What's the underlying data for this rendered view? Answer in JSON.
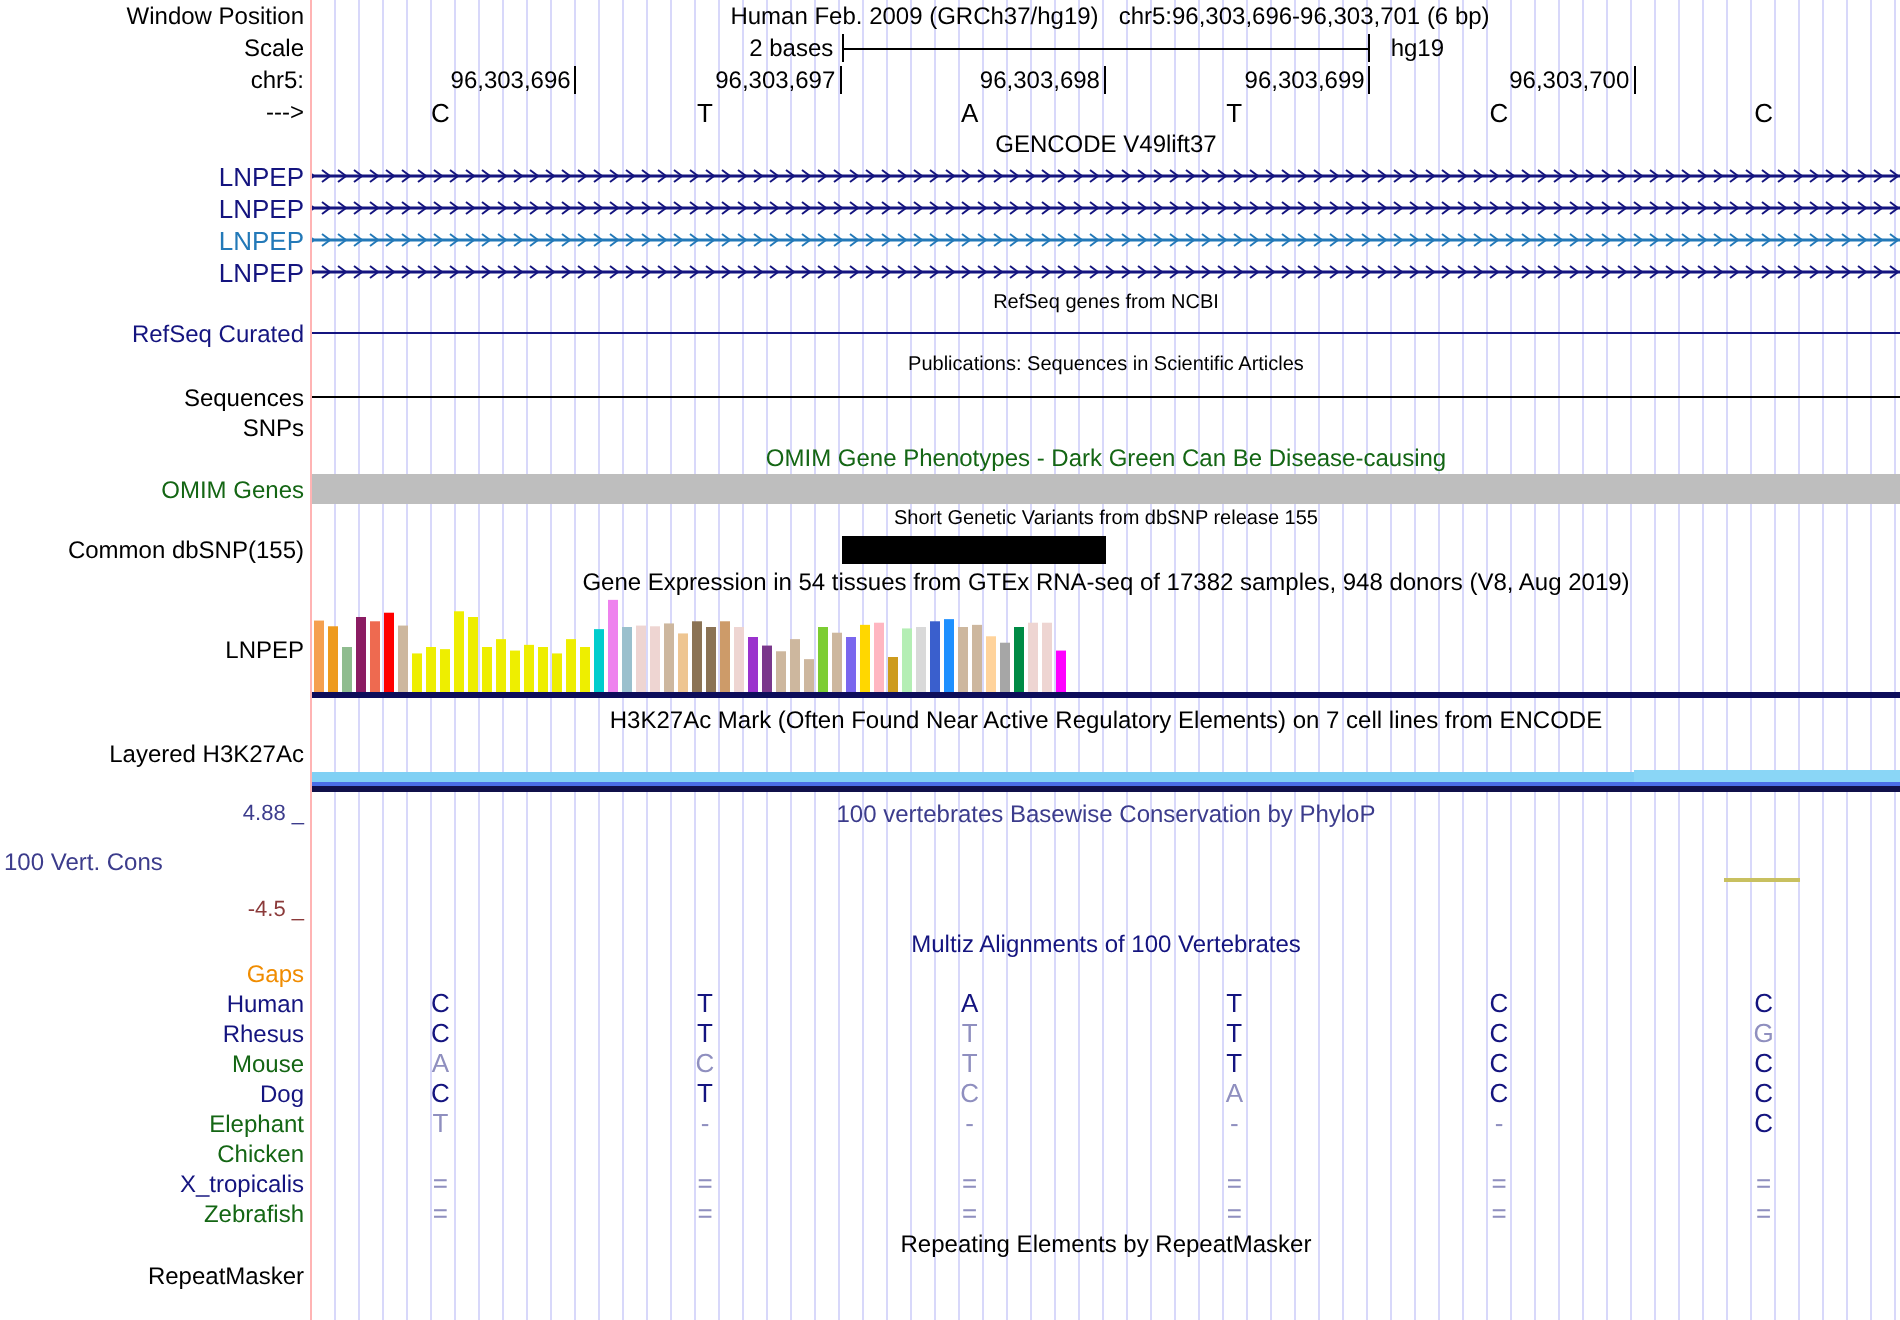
{
  "window_position": {
    "label": "Window Position",
    "assembly": "Human Feb. 2009 (GRCh37/hg19)",
    "range": "chr5:96,303,696-96,303,701 (6 bp)"
  },
  "scale": {
    "label": "Scale",
    "length": "2 bases",
    "assembly": "hg19"
  },
  "ruler": {
    "label": "chr5:",
    "ticks": [
      "96,303,696",
      "96,303,697",
      "96,303,698",
      "96,303,699",
      "96,303,700"
    ]
  },
  "sequence": {
    "label": "--->",
    "bases": [
      "C",
      "T",
      "A",
      "T",
      "C",
      "C"
    ]
  },
  "gencode": {
    "title": "GENCODE V49lift37",
    "transcripts": [
      {
        "label": "LNPEP",
        "color": "#14147f"
      },
      {
        "label": "LNPEP",
        "color": "#14147f"
      },
      {
        "label": "LNPEP",
        "color": "#2379b8"
      },
      {
        "label": "LNPEP",
        "color": "#14147f"
      }
    ]
  },
  "refseq": {
    "title": "RefSeq genes from NCBI",
    "label": "RefSeq Curated"
  },
  "publications": {
    "title": "Publications: Sequences in Scientific Articles",
    "label": "Sequences"
  },
  "snps": {
    "label": "SNPs"
  },
  "omim": {
    "title": "OMIM Gene Phenotypes - Dark Green Can Be Disease-causing",
    "label": "OMIM Genes"
  },
  "dbsnp": {
    "title": "Short Genetic Variants from dbSNP release 155",
    "label": "Common dbSNP(155)"
  },
  "gtex": {
    "title": "Gene Expression in 54 tissues from GTEx RNA-seq of 17382 samples, 948 donors (V8, Aug 2019)",
    "label": "LNPEP"
  },
  "h3k27ac": {
    "title": "H3K27Ac Mark (Often Found Near Active Regulatory Elements) on 7 cell lines from ENCODE",
    "label": "Layered H3K27Ac"
  },
  "conservation": {
    "title": "100 vertebrates Basewise Conservation by PhyloP",
    "label": "100 Vert. Cons",
    "max": "4.88 _",
    "min": "-4.5 _"
  },
  "multiz": {
    "title": "Multiz Alignments of 100 Vertebrates",
    "gaps_label": "Gaps",
    "species": [
      {
        "name": "Human",
        "color": "#14147f",
        "bases": [
          {
            "text": "C",
            "match": true
          },
          {
            "text": "T",
            "match": true
          },
          {
            "text": "A",
            "match": true
          },
          {
            "text": "T",
            "match": true
          },
          {
            "text": "C",
            "match": true
          },
          {
            "text": "C",
            "match": true
          }
        ]
      },
      {
        "name": "Rhesus",
        "color": "#14147f",
        "bases": [
          {
            "text": "C",
            "match": true
          },
          {
            "text": "T",
            "match": true
          },
          {
            "text": "T",
            "match": false
          },
          {
            "text": "T",
            "match": true
          },
          {
            "text": "C",
            "match": true
          },
          {
            "text": "G",
            "match": false
          }
        ]
      },
      {
        "name": "Mouse",
        "color": "#146614",
        "bases": [
          {
            "text": "A",
            "match": false
          },
          {
            "text": "C",
            "match": false
          },
          {
            "text": "T",
            "match": false
          },
          {
            "text": "T",
            "match": true
          },
          {
            "text": "C",
            "match": true
          },
          {
            "text": "C",
            "match": true
          }
        ]
      },
      {
        "name": "Dog",
        "color": "#14147f",
        "bases": [
          {
            "text": "C",
            "match": true
          },
          {
            "text": "T",
            "match": true
          },
          {
            "text": "C",
            "match": false
          },
          {
            "text": "A",
            "match": false
          },
          {
            "text": "C",
            "match": true
          },
          {
            "text": "C",
            "match": true
          }
        ]
      },
      {
        "name": "Elephant",
        "color": "#146614",
        "bases": [
          {
            "text": "T",
            "match": false
          },
          {
            "text": "-",
            "match": false
          },
          {
            "text": "-",
            "match": false
          },
          {
            "text": "-",
            "match": false
          },
          {
            "text": "-",
            "match": false
          },
          {
            "text": "C",
            "match": true
          }
        ]
      },
      {
        "name": "Chicken",
        "color": "#146614"
      },
      {
        "name": "X_tropicalis",
        "color": "#14147f",
        "bases": [
          {
            "text": "=",
            "match": false
          },
          {
            "text": "=",
            "match": false
          },
          {
            "text": "=",
            "match": false
          },
          {
            "text": "=",
            "match": false
          },
          {
            "text": "=",
            "match": false
          },
          {
            "text": "=",
            "match": false
          }
        ]
      },
      {
        "name": "Zebrafish",
        "color": "#146614",
        "bases": [
          {
            "text": "=",
            "match": false
          },
          {
            "text": "=",
            "match": false
          },
          {
            "text": "=",
            "match": false
          },
          {
            "text": "=",
            "match": false
          },
          {
            "text": "=",
            "match": false
          },
          {
            "text": "=",
            "match": false
          }
        ]
      }
    ]
  },
  "repeatmasker": {
    "title": "Repeating Elements by RepeatMasker",
    "label": "RepeatMasker"
  }
}
